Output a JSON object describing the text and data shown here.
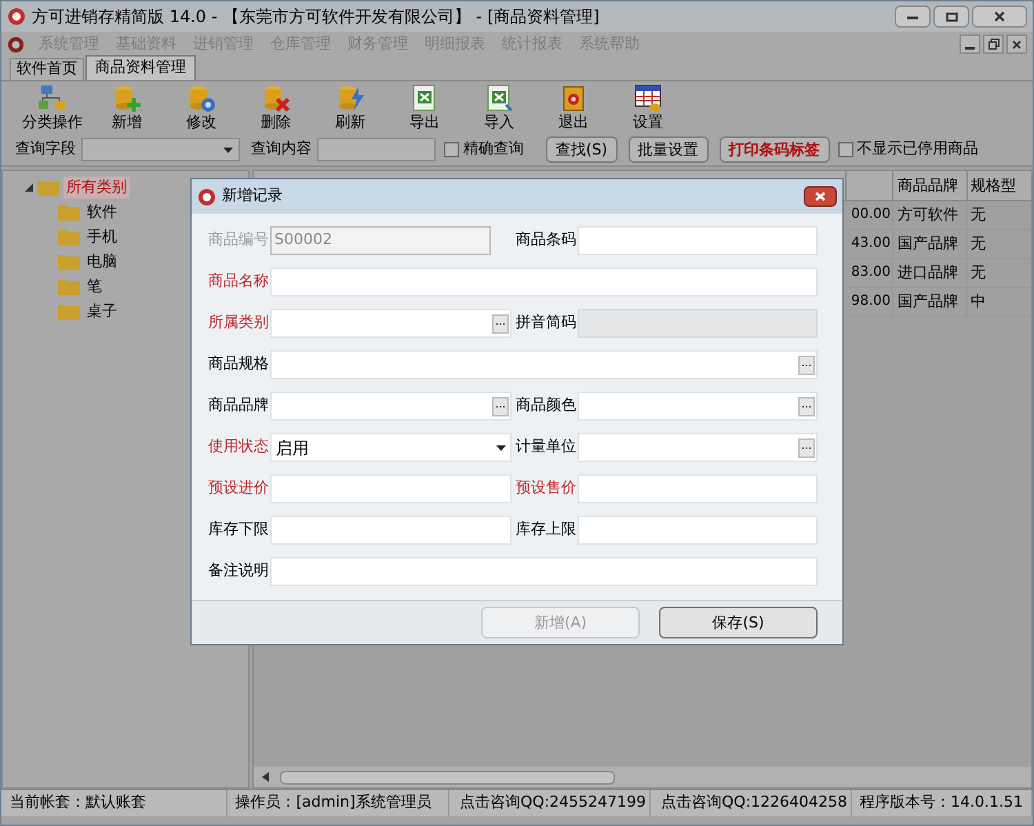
{
  "window": {
    "title": "方可进销存精简版 14.0 - 【东莞市方可软件开发有限公司】 - [商品资料管理]"
  },
  "menu": [
    {
      "label": "系统管理",
      "disabled": true
    },
    {
      "label": "基础资料",
      "disabled": true
    },
    {
      "label": "进销管理",
      "disabled": true
    },
    {
      "label": "仓库管理",
      "disabled": true
    },
    {
      "label": "财务管理",
      "disabled": true
    },
    {
      "label": "明细报表",
      "disabled": true
    },
    {
      "label": "统计报表",
      "disabled": true
    },
    {
      "label": "系统帮助",
      "disabled": true
    }
  ],
  "tabs": [
    {
      "label": "软件首页",
      "selected": false
    },
    {
      "label": "商品资料管理",
      "selected": true
    }
  ],
  "toolbar": [
    {
      "label": "分类操作",
      "kind": "tree"
    },
    {
      "label": "新增",
      "kind": "add"
    },
    {
      "label": "修改",
      "kind": "edit"
    },
    {
      "label": "删除",
      "kind": "delete"
    },
    {
      "label": "刷新",
      "kind": "refresh"
    },
    {
      "label": "导出",
      "kind": "export"
    },
    {
      "label": "导入",
      "kind": "import"
    },
    {
      "label": "退出",
      "kind": "exit"
    },
    {
      "label": "设置",
      "kind": "settings"
    }
  ],
  "query": {
    "field_label": "查询字段",
    "content_label": "查询内容",
    "exact": {
      "label": "精确查询",
      "checked": false
    },
    "buttons": [
      {
        "label": "查找(S)",
        "emphasis": false
      },
      {
        "label": "批量设置",
        "emphasis": false
      },
      {
        "label": "打印条码标签",
        "emphasis": true
      }
    ],
    "hide_disabled": {
      "label": "不显示已停用商品",
      "checked": false
    }
  },
  "tree": {
    "label": "所有类别",
    "selected": true,
    "expanded": true,
    "children": [
      {
        "label": "软件",
        "selected": false
      },
      {
        "label": "手机",
        "selected": false
      },
      {
        "label": "电脑",
        "selected": false
      },
      {
        "label": "笔",
        "selected": false
      },
      {
        "label": "桌子",
        "selected": false
      }
    ]
  },
  "table": {
    "columns": [
      "商品品牌",
      "规格型"
    ],
    "rows": [
      {
        "column_1": "00.00",
        "brand": "方可软件",
        "spec": "无"
      },
      {
        "column_1": "43.00",
        "brand": "国产品牌",
        "spec": "无"
      },
      {
        "column_1": "83.00",
        "brand": "进口品牌",
        "spec": "无"
      },
      {
        "column_1": "98.00",
        "brand": "国产品牌",
        "spec": "中"
      }
    ]
  },
  "dialog": {
    "title": "新增记录",
    "rows": [
      [
        {
          "label": "商品编号",
          "kind": "text",
          "disabled": true,
          "required": false,
          "value": "S00002"
        },
        {
          "label": "商品条码",
          "kind": "text",
          "disabled": false,
          "required": false
        }
      ],
      [
        {
          "label": "商品名称",
          "kind": "text",
          "disabled": false,
          "required": true
        }
      ],
      [
        {
          "label": "所属类别",
          "kind": "lookup",
          "disabled": false,
          "required": true
        },
        {
          "label": "拼音简码",
          "kind": "readonly",
          "disabled": false,
          "required": false
        }
      ],
      [
        {
          "label": "商品规格",
          "kind": "lookup",
          "disabled": false,
          "required": false
        }
      ],
      [
        {
          "label": "商品品牌",
          "kind": "lookup",
          "disabled": false,
          "required": false
        },
        {
          "label": "商品颜色",
          "kind": "lookup",
          "disabled": false,
          "required": false
        }
      ],
      [
        {
          "label": "使用状态",
          "kind": "select",
          "disabled": false,
          "required": true,
          "value": "启用"
        },
        {
          "label": "计量单位",
          "kind": "lookup",
          "disabled": false,
          "required": false
        }
      ],
      [
        {
          "label": "预设进价",
          "kind": "text",
          "disabled": false,
          "required": true
        },
        {
          "label": "预设售价",
          "kind": "text",
          "disabled": false,
          "required": true
        }
      ],
      [
        {
          "label": "库存下限",
          "kind": "text",
          "disabled": false,
          "required": false
        },
        {
          "label": "库存上限",
          "kind": "text",
          "disabled": false,
          "required": false
        }
      ],
      [
        {
          "label": "备注说明",
          "kind": "text",
          "disabled": false,
          "required": false
        }
      ]
    ],
    "buttons": [
      {
        "label": "新增(A)",
        "disabled": true
      },
      {
        "label": "保存(S)",
        "disabled": false
      }
    ]
  },
  "status_bar": [
    {
      "text": "当前帐套：默认账套",
      "qq": false
    },
    {
      "text": "操作员：[admin]系统管理员",
      "qq": false
    },
    {
      "text": "点击咨询QQ:2455247199",
      "qq": true
    },
    {
      "text": "点击咨询QQ:1226404258",
      "qq": true
    },
    {
      "text": "程序版本号：14.0.1.51",
      "qq": false
    }
  ]
}
